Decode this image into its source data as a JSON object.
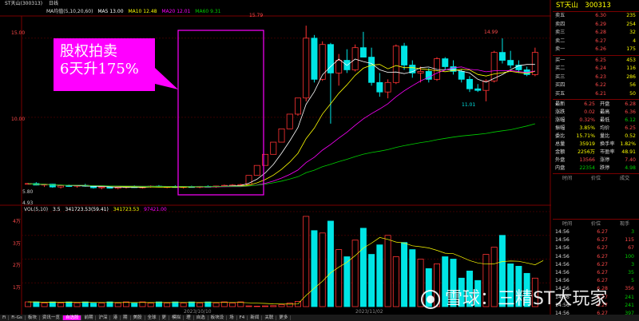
{
  "topbar": {
    "stock_name": "ST天山(300313)",
    "period": "日线"
  },
  "ma_legend": {
    "label": "MA均值(5,10,20,60)",
    "items": [
      {
        "text": "MA5 13.00",
        "color": "#ffffff"
      },
      {
        "text": "MA10 12.48",
        "color": "#ffff00"
      },
      {
        "text": "MA20 12.01",
        "color": "#ff00ff"
      },
      {
        "text": "MA60 9.31",
        "color": "#00d000"
      }
    ]
  },
  "vol_legend": {
    "label": "VOL(5,10)",
    "items": [
      {
        "text": "3.5",
        "color": "#ffffff"
      },
      {
        "text": "341723.53(59.41)",
        "color": "#ffffff"
      },
      {
        "text": "341723.53",
        "color": "#ffff00"
      },
      {
        "text": "97421.00",
        "color": "#ff00ff"
      }
    ]
  },
  "price_axis": {
    "top": "15.00",
    "mid": "10.00"
  },
  "vol_axis": [
    "4万",
    "3万",
    "2万",
    "1万"
  ],
  "annotations": {
    "high": "15.79",
    "high2": "14.99",
    "low": "11.01",
    "start": "5.80",
    "start_low": "4.93"
  },
  "date_labels": [
    "2023/10/10",
    "2023/11/02"
  ],
  "callout": {
    "line1": "股权拍卖",
    "line2": "6天升175%"
  },
  "chart_data": {
    "type": "candlestick",
    "candles": [
      {
        "o": 5.8,
        "h": 5.85,
        "l": 5.75,
        "c": 5.82
      },
      {
        "o": 5.82,
        "h": 5.9,
        "l": 5.7,
        "c": 5.72
      },
      {
        "o": 5.72,
        "h": 5.8,
        "l": 5.6,
        "c": 5.78
      },
      {
        "o": 5.78,
        "h": 5.8,
        "l": 5.55,
        "c": 5.6
      },
      {
        "o": 5.6,
        "h": 5.7,
        "l": 5.5,
        "c": 5.68
      },
      {
        "o": 5.68,
        "h": 5.75,
        "l": 5.6,
        "c": 5.65
      },
      {
        "o": 5.65,
        "h": 5.72,
        "l": 5.55,
        "c": 5.7
      },
      {
        "o": 5.7,
        "h": 5.8,
        "l": 5.62,
        "c": 5.66
      },
      {
        "o": 5.66,
        "h": 5.7,
        "l": 5.5,
        "c": 5.55
      },
      {
        "o": 5.55,
        "h": 5.62,
        "l": 5.45,
        "c": 5.6
      },
      {
        "o": 5.6,
        "h": 5.68,
        "l": 5.5,
        "c": 5.52
      },
      {
        "o": 5.52,
        "h": 5.6,
        "l": 5.45,
        "c": 5.58
      },
      {
        "o": 5.58,
        "h": 5.66,
        "l": 5.5,
        "c": 5.62
      },
      {
        "o": 5.62,
        "h": 5.7,
        "l": 5.55,
        "c": 5.56
      },
      {
        "o": 5.56,
        "h": 5.64,
        "l": 5.5,
        "c": 5.6
      },
      {
        "o": 5.6,
        "h": 5.7,
        "l": 5.55,
        "c": 5.65
      },
      {
        "o": 5.65,
        "h": 5.72,
        "l": 5.58,
        "c": 5.6
      },
      {
        "o": 5.6,
        "h": 5.66,
        "l": 5.52,
        "c": 5.62
      },
      {
        "o": 5.62,
        "h": 5.7,
        "l": 5.55,
        "c": 5.58
      },
      {
        "o": 5.58,
        "h": 5.64,
        "l": 5.5,
        "c": 5.62
      },
      {
        "o": 5.62,
        "h": 5.68,
        "l": 5.56,
        "c": 5.6
      },
      {
        "o": 5.6,
        "h": 5.66,
        "l": 5.52,
        "c": 5.64
      },
      {
        "o": 5.64,
        "h": 5.7,
        "l": 5.58,
        "c": 5.62
      },
      {
        "o": 5.62,
        "h": 5.68,
        "l": 5.55,
        "c": 5.66
      },
      {
        "o": 5.66,
        "h": 5.75,
        "l": 5.6,
        "c": 5.7
      },
      {
        "o": 5.7,
        "h": 5.78,
        "l": 5.64,
        "c": 5.72
      },
      {
        "o": 5.72,
        "h": 5.8,
        "l": 5.66,
        "c": 5.75
      },
      {
        "o": 5.75,
        "h": 6.33,
        "l": 5.75,
        "c": 6.33
      },
      {
        "o": 6.33,
        "h": 6.96,
        "l": 6.33,
        "c": 6.96
      },
      {
        "o": 6.96,
        "h": 7.66,
        "l": 6.96,
        "c": 7.66
      },
      {
        "o": 7.66,
        "h": 8.43,
        "l": 7.66,
        "c": 8.43
      },
      {
        "o": 8.43,
        "h": 9.27,
        "l": 8.43,
        "c": 9.27
      },
      {
        "o": 9.27,
        "h": 10.2,
        "l": 9.27,
        "c": 10.2
      },
      {
        "o": 10.2,
        "h": 11.22,
        "l": 10.1,
        "c": 11.22
      },
      {
        "o": 11.22,
        "h": 15.79,
        "l": 11.0,
        "c": 15.0
      },
      {
        "o": 15.0,
        "h": 15.2,
        "l": 12.2,
        "c": 12.4
      },
      {
        "o": 12.4,
        "h": 14.8,
        "l": 12.3,
        "c": 14.6
      },
      {
        "o": 14.6,
        "h": 14.7,
        "l": 9.6,
        "c": 12.8
      },
      {
        "o": 12.8,
        "h": 14.0,
        "l": 12.0,
        "c": 13.6
      },
      {
        "o": 13.6,
        "h": 14.3,
        "l": 12.8,
        "c": 13.0
      },
      {
        "o": 13.0,
        "h": 14.6,
        "l": 12.9,
        "c": 14.4
      },
      {
        "o": 14.4,
        "h": 15.4,
        "l": 13.8,
        "c": 13.8
      },
      {
        "o": 13.8,
        "h": 14.4,
        "l": 12.0,
        "c": 12.2
      },
      {
        "o": 12.2,
        "h": 12.8,
        "l": 11.3,
        "c": 11.6
      },
      {
        "o": 11.6,
        "h": 12.4,
        "l": 11.2,
        "c": 12.2
      },
      {
        "o": 12.2,
        "h": 14.6,
        "l": 12.1,
        "c": 14.5
      },
      {
        "o": 14.5,
        "h": 14.7,
        "l": 13.0,
        "c": 13.3
      },
      {
        "o": 13.3,
        "h": 13.6,
        "l": 12.5,
        "c": 12.8
      },
      {
        "o": 12.8,
        "h": 13.2,
        "l": 12.2,
        "c": 12.9
      },
      {
        "o": 12.9,
        "h": 13.1,
        "l": 12.2,
        "c": 12.4
      },
      {
        "o": 12.4,
        "h": 13.8,
        "l": 12.3,
        "c": 13.7
      },
      {
        "o": 13.7,
        "h": 13.8,
        "l": 13.0,
        "c": 13.2
      },
      {
        "o": 13.2,
        "h": 13.6,
        "l": 12.7,
        "c": 12.9
      },
      {
        "o": 12.9,
        "h": 13.0,
        "l": 12.2,
        "c": 12.4
      },
      {
        "o": 12.4,
        "h": 12.6,
        "l": 11.6,
        "c": 11.8
      },
      {
        "o": 11.8,
        "h": 12.1,
        "l": 11.6,
        "c": 11.7
      },
      {
        "o": 11.7,
        "h": 12.4,
        "l": 11.01,
        "c": 12.3
      },
      {
        "o": 12.3,
        "h": 14.2,
        "l": 12.2,
        "c": 14.1
      },
      {
        "o": 14.1,
        "h": 14.99,
        "l": 13.4,
        "c": 13.6
      },
      {
        "o": 13.6,
        "h": 14.2,
        "l": 13.1,
        "c": 13.3
      },
      {
        "o": 13.3,
        "h": 13.6,
        "l": 12.8,
        "c": 13.0
      },
      {
        "o": 13.0,
        "h": 13.2,
        "l": 12.6,
        "c": 12.7
      },
      {
        "o": 12.7,
        "h": 14.4,
        "l": 12.6,
        "c": 14.1
      }
    ],
    "volume": [
      2,
      2,
      1.5,
      2,
      1.5,
      2,
      1.5,
      2,
      1.5,
      1.5,
      2,
      1.5,
      2,
      1.5,
      2,
      1.5,
      2,
      1.5,
      2,
      1.5,
      2,
      1.5,
      2,
      1.5,
      2,
      1.5,
      2,
      0.3,
      0.2,
      0.3,
      0.4,
      0.8,
      1.5,
      2.2,
      38,
      32,
      31,
      36,
      24,
      21,
      28,
      33,
      22,
      26,
      30,
      21,
      27,
      24,
      20,
      16,
      18,
      21,
      20,
      12,
      15,
      11,
      22,
      25,
      30,
      18,
      17,
      14,
      12,
      30
    ],
    "ylim": [
      4.8,
      16.2
    ],
    "vol_max": 40
  },
  "order_book": {
    "title_name": "ST天山",
    "title_code": "300313",
    "asks": [
      {
        "label": "卖五",
        "price": "6.30",
        "vol": "235"
      },
      {
        "label": "卖四",
        "price": "6.29",
        "vol": "254"
      },
      {
        "label": "卖三",
        "price": "6.28",
        "vol": "32"
      },
      {
        "label": "卖二",
        "price": "6.27",
        "vol": "4"
      },
      {
        "label": "卖一",
        "price": "6.26",
        "vol": "175"
      }
    ],
    "bids": [
      {
        "label": "买一",
        "price": "6.25",
        "vol": "453"
      },
      {
        "label": "买二",
        "price": "6.24",
        "vol": "116"
      },
      {
        "label": "买三",
        "price": "6.23",
        "vol": "286"
      },
      {
        "label": "买四",
        "price": "6.22",
        "vol": "56"
      },
      {
        "label": "买五",
        "price": "6.21",
        "vol": "50"
      }
    ]
  },
  "quote": [
    {
      "l": "最新",
      "v": "6.25",
      "vc": "red",
      "l2": "开盘",
      "v2": "6.28",
      "v2c": "red"
    },
    {
      "l": "涨跌",
      "v": "0.02",
      "vc": "red",
      "l2": "最高",
      "v2": "6.36",
      "v2c": "red"
    },
    {
      "l": "涨幅",
      "v": "0.32%",
      "vc": "red",
      "l2": "最低",
      "v2": "6.12",
      "v2c": "grn"
    },
    {
      "l": "振幅",
      "v": "3.85%",
      "vc": "yel",
      "l2": "均价",
      "v2": "6.25",
      "v2c": "red"
    },
    {
      "l": "委比",
      "v": "15.71%",
      "vc": "yel",
      "l2": "量比",
      "v2": "0.52",
      "v2c": "yel"
    },
    {
      "l": "总量",
      "v": "35919",
      "vc": "yel",
      "l2": "换手率",
      "v2": "1.82%",
      "v2c": "yel"
    },
    {
      "l": "金额",
      "v": "2256万",
      "vc": "yel",
      "l2": "市盈率",
      "v2": "48.91",
      "v2c": "yel"
    },
    {
      "l": "外盘",
      "v": "13566",
      "vc": "red",
      "l2": "涨停",
      "v2": "7.40",
      "v2c": "red"
    },
    {
      "l": "内盘",
      "v": "22354",
      "vc": "grn",
      "l2": "跌停",
      "v2": "4.98",
      "v2c": "grn"
    }
  ],
  "ticks_header": [
    "时间",
    "价位",
    "成交"
  ],
  "ticks_header2": [
    "时间",
    "价位",
    "现手"
  ],
  "ticks": [
    {
      "t": "14:56",
      "p": "6.27",
      "v": "3",
      "vc": "grn"
    },
    {
      "t": "14:56",
      "p": "6.27",
      "v": "115",
      "vc": "red"
    },
    {
      "t": "14:56",
      "p": "6.27",
      "v": "67",
      "vc": "red"
    },
    {
      "t": "14:56",
      "p": "6.27",
      "v": "100",
      "vc": "grn"
    },
    {
      "t": "14:56",
      "p": "6.27",
      "v": "3",
      "vc": "grn"
    },
    {
      "t": "14:56",
      "p": "6.27",
      "v": "35",
      "vc": "grn"
    },
    {
      "t": "14:56",
      "p": "6.27",
      "v": "5",
      "vc": "grn"
    },
    {
      "t": "14:56",
      "p": "6.28",
      "v": "356",
      "vc": "red"
    },
    {
      "t": "14:56",
      "p": "6.27",
      "v": "241",
      "vc": "grn"
    },
    {
      "t": "14:56",
      "p": "6.27",
      "v": "241",
      "vc": "grn"
    },
    {
      "t": "14:56",
      "p": "6.27",
      "v": "397",
      "vc": "grn"
    }
  ],
  "bottombar": [
    "Fi",
    "Fi-Gs",
    "板块",
    "资讯一览",
    "自选股",
    "前期",
    "沪深",
    "港",
    "期",
    "美股",
    "全球",
    "更",
    "模拟",
    "理",
    "自选",
    "板块设",
    "场",
    "F4",
    "新闻",
    "关联",
    "更多"
  ],
  "watermark": "雪球：三精ST大玩家"
}
